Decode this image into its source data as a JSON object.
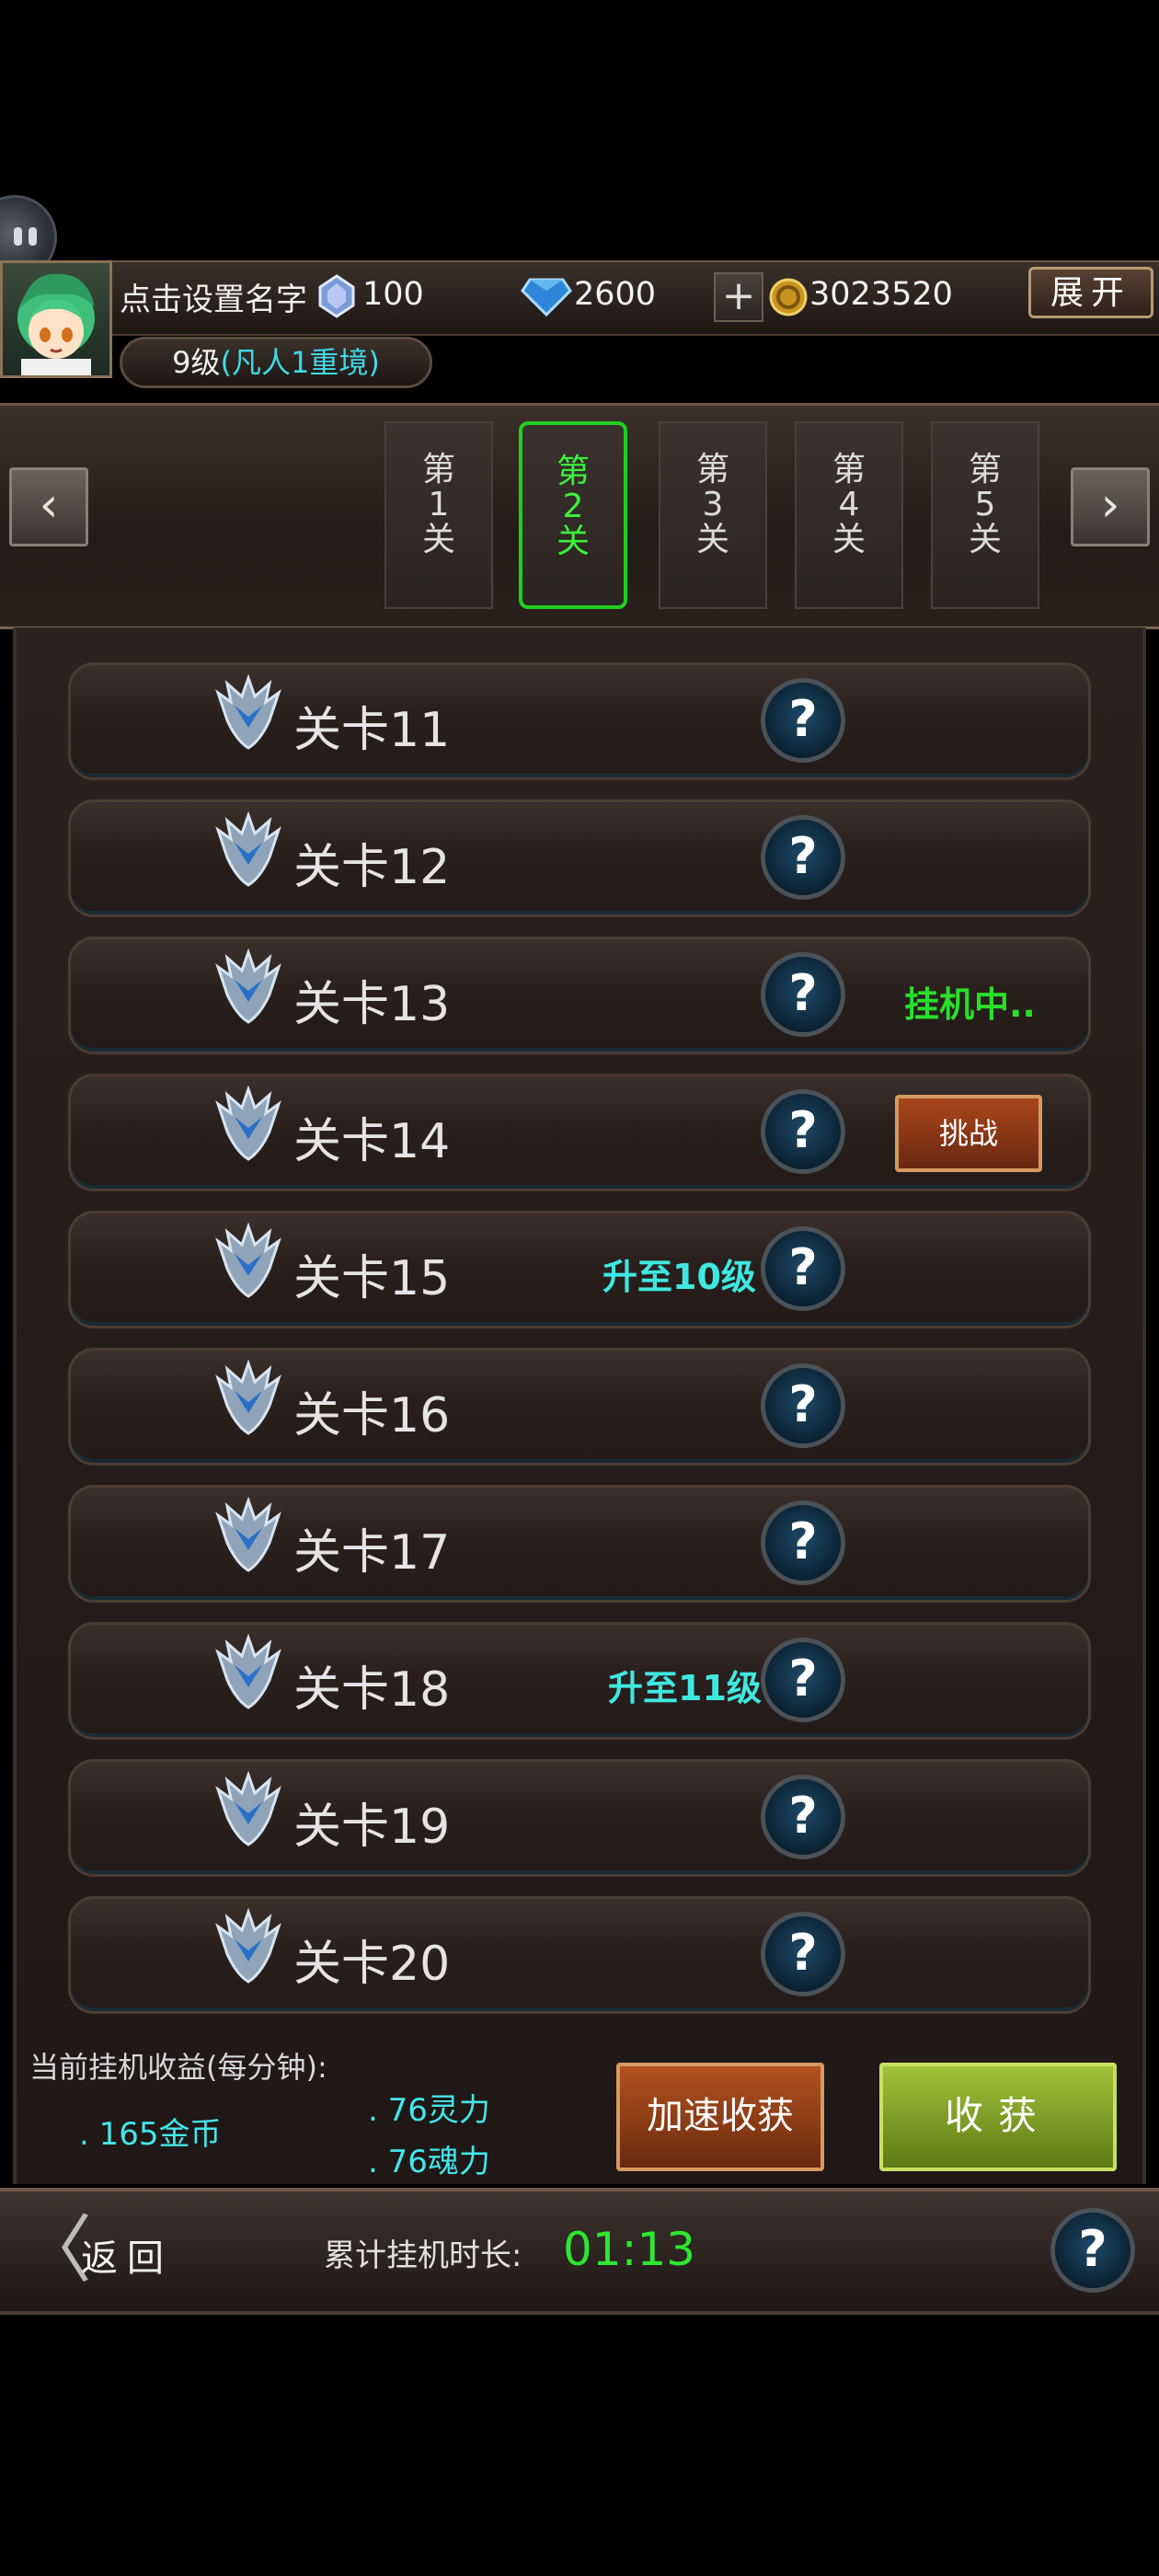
{
  "header": {
    "player_name": "点击设置名字",
    "resources": [
      {
        "icon": "crystal-icon",
        "value": "100"
      },
      {
        "icon": "diamond-icon",
        "value": "2600"
      },
      {
        "icon": "gold-coin-icon",
        "value": "3023520",
        "add_label": "+"
      }
    ],
    "expand_label": "展开",
    "level_text": "9级",
    "realm_text": "(凡人1重境)"
  },
  "chapters": {
    "prev_label": "‹",
    "next_label": "›",
    "tabs": [
      {
        "label": "第\n1\n关",
        "active": false
      },
      {
        "label": "第\n2\n关",
        "active": true
      },
      {
        "label": "第\n3\n关",
        "active": false
      },
      {
        "label": "第\n4\n关",
        "active": false
      },
      {
        "label": "第\n5\n关",
        "active": false
      }
    ]
  },
  "stages": [
    {
      "label": "关卡11",
      "help": "?",
      "status": "",
      "unlock": "",
      "button": ""
    },
    {
      "label": "关卡12",
      "help": "?",
      "status": "",
      "unlock": "",
      "button": ""
    },
    {
      "label": "关卡13",
      "help": "?",
      "status": "挂机中..",
      "unlock": "",
      "button": ""
    },
    {
      "label": "关卡14",
      "help": "?",
      "status": "",
      "unlock": "",
      "button": "挑战"
    },
    {
      "label": "关卡15",
      "help": "?",
      "status": "",
      "unlock": "升至10级",
      "button": ""
    },
    {
      "label": "关卡16",
      "help": "?",
      "status": "",
      "unlock": "",
      "button": ""
    },
    {
      "label": "关卡17",
      "help": "?",
      "status": "",
      "unlock": "",
      "button": ""
    },
    {
      "label": "关卡18",
      "help": "?",
      "status": "",
      "unlock": "升至11级",
      "button": ""
    },
    {
      "label": "关卡19",
      "help": "?",
      "status": "",
      "unlock": "",
      "button": ""
    },
    {
      "label": "关卡20",
      "help": "?",
      "status": "",
      "unlock": "",
      "button": ""
    }
  ],
  "earnings": {
    "title": "当前挂机收益(每分钟):",
    "gold": ". 165金币",
    "spirit": ". 76灵力",
    "soul": ". 76魂力",
    "speed_label": "加速收获",
    "harvest_label": "收获"
  },
  "footer": {
    "back_label": "返回",
    "time_label": "累计挂机时长:",
    "time_value": "01:13",
    "help": "?"
  },
  "colors": {
    "active_green": "#1fd01f",
    "status_green": "#28e02a",
    "unlock_cyan": "#3fe8e0",
    "gain_cyan": "#44e6ea"
  }
}
